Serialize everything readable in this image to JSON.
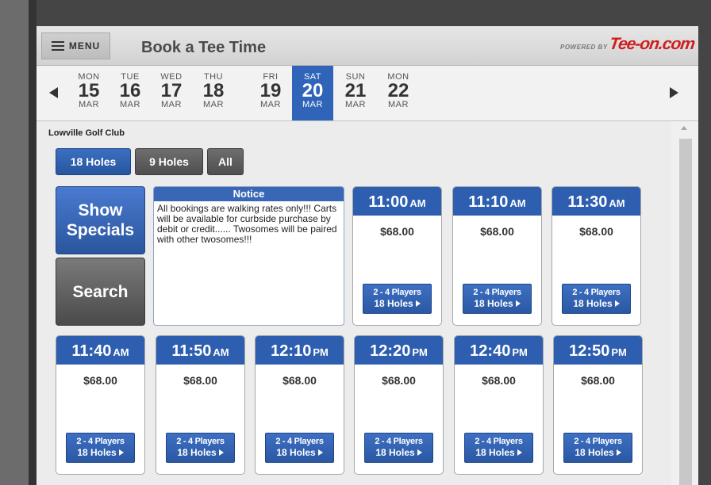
{
  "header": {
    "menu_label": "MENU",
    "title": "Book a Tee Time",
    "powered_by": "POWERED BY",
    "brand": "Tee-on.com"
  },
  "dates": [
    {
      "dow": "MON",
      "day": "15",
      "mon": "MAR",
      "active": false
    },
    {
      "dow": "TUE",
      "day": "16",
      "mon": "MAR",
      "active": false
    },
    {
      "dow": "WED",
      "day": "17",
      "mon": "MAR",
      "active": false
    },
    {
      "dow": "THU",
      "day": "18",
      "mon": "MAR",
      "active": false
    },
    {
      "dow": "FRI",
      "day": "19",
      "mon": "MAR",
      "active": false
    },
    {
      "dow": "SAT",
      "day": "20",
      "mon": "MAR",
      "active": true
    },
    {
      "dow": "SUN",
      "day": "21",
      "mon": "MAR",
      "active": false
    },
    {
      "dow": "MON",
      "day": "22",
      "mon": "MAR",
      "active": false
    }
  ],
  "club_name": "Lowville Golf Club",
  "filters": [
    {
      "label": "18 Holes",
      "active": true
    },
    {
      "label": "9 Holes",
      "active": false
    },
    {
      "label": "All",
      "active": false
    }
  ],
  "buttons": {
    "specials": "Show Specials",
    "search": "Search"
  },
  "notice": {
    "title": "Notice",
    "body": "All bookings are walking rates only!!! Carts will be available for curbside purchase by debit or credit...... Twosomes will be paired with other twosomes!!!"
  },
  "slots": [
    {
      "time": "11:00",
      "ampm": "AM",
      "price": "$68.00",
      "players": "2 - 4 Players",
      "holes": "18 Holes"
    },
    {
      "time": "11:10",
      "ampm": "AM",
      "price": "$68.00",
      "players": "2 - 4 Players",
      "holes": "18 Holes"
    },
    {
      "time": "11:30",
      "ampm": "AM",
      "price": "$68.00",
      "players": "2 - 4 Players",
      "holes": "18 Holes"
    },
    {
      "time": "11:40",
      "ampm": "AM",
      "price": "$68.00",
      "players": "2 - 4 Players",
      "holes": "18 Holes"
    },
    {
      "time": "11:50",
      "ampm": "AM",
      "price": "$68.00",
      "players": "2 - 4 Players",
      "holes": "18 Holes"
    },
    {
      "time": "12:10",
      "ampm": "PM",
      "price": "$68.00",
      "players": "2 - 4 Players",
      "holes": "18 Holes"
    },
    {
      "time": "12:20",
      "ampm": "PM",
      "price": "$68.00",
      "players": "2 - 4 Players",
      "holes": "18 Holes"
    },
    {
      "time": "12:40",
      "ampm": "PM",
      "price": "$68.00",
      "players": "2 - 4 Players",
      "holes": "18 Holes"
    },
    {
      "time": "12:50",
      "ampm": "PM",
      "price": "$68.00",
      "players": "2 - 4 Players",
      "holes": "18 Holes"
    }
  ],
  "colors": {
    "accent": "#2d5eb0",
    "brand_red": "#d01c1c"
  }
}
